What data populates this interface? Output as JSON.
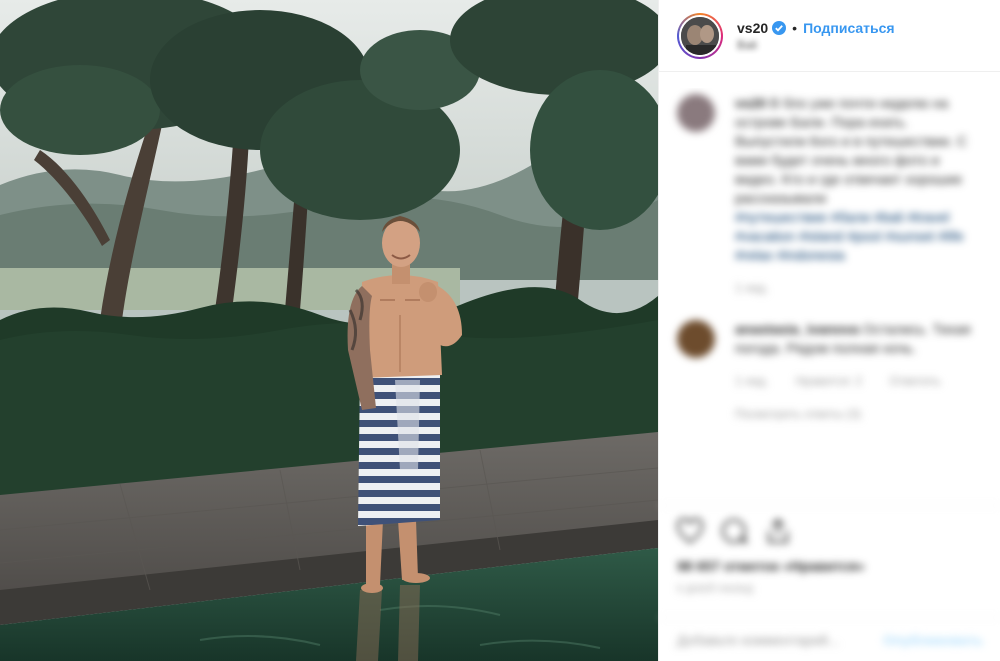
{
  "header": {
    "username": "vs20",
    "verified_icon": "verified-badge-icon",
    "separator": "•",
    "follow_label": "Подписаться",
    "location": "Bali"
  },
  "caption": {
    "username": "vs20",
    "text": "В бло уже почти неделю на острове Бали. Пора ехать. Выпустили 6ого и в путешествии. С вами будет очень много фото и видео. Кто и где отвечает хорошие рассказывали",
    "hashtags": "#путешествие #бали #bali #travel #vacation #island #pool #sunset #life #relax #indonesia",
    "time": "1 нед."
  },
  "comment": {
    "username": "anastasia_ivanova",
    "text": "Остались. Тихая погода. Рядом полная ночь.",
    "time": "1 нед.",
    "likes": "Нравится: 2",
    "reply": "Ответить",
    "view_replies": "Посмотреть ответы (3)"
  },
  "actions": {
    "like_icon": "heart-icon",
    "comment_icon": "comment-icon",
    "share_icon": "share-icon",
    "bookmark_icon": "bookmark-icon",
    "likes_text": "98 657 отметок «Нравится»",
    "post_time": "5 ДНЕЙ НАЗАД"
  },
  "add_comment": {
    "placeholder": "Добавьте комментарий...",
    "publish_label": "Опубликовать"
  },
  "colors": {
    "accent": "#3897f0",
    "text": "#262626",
    "muted": "#999999"
  }
}
